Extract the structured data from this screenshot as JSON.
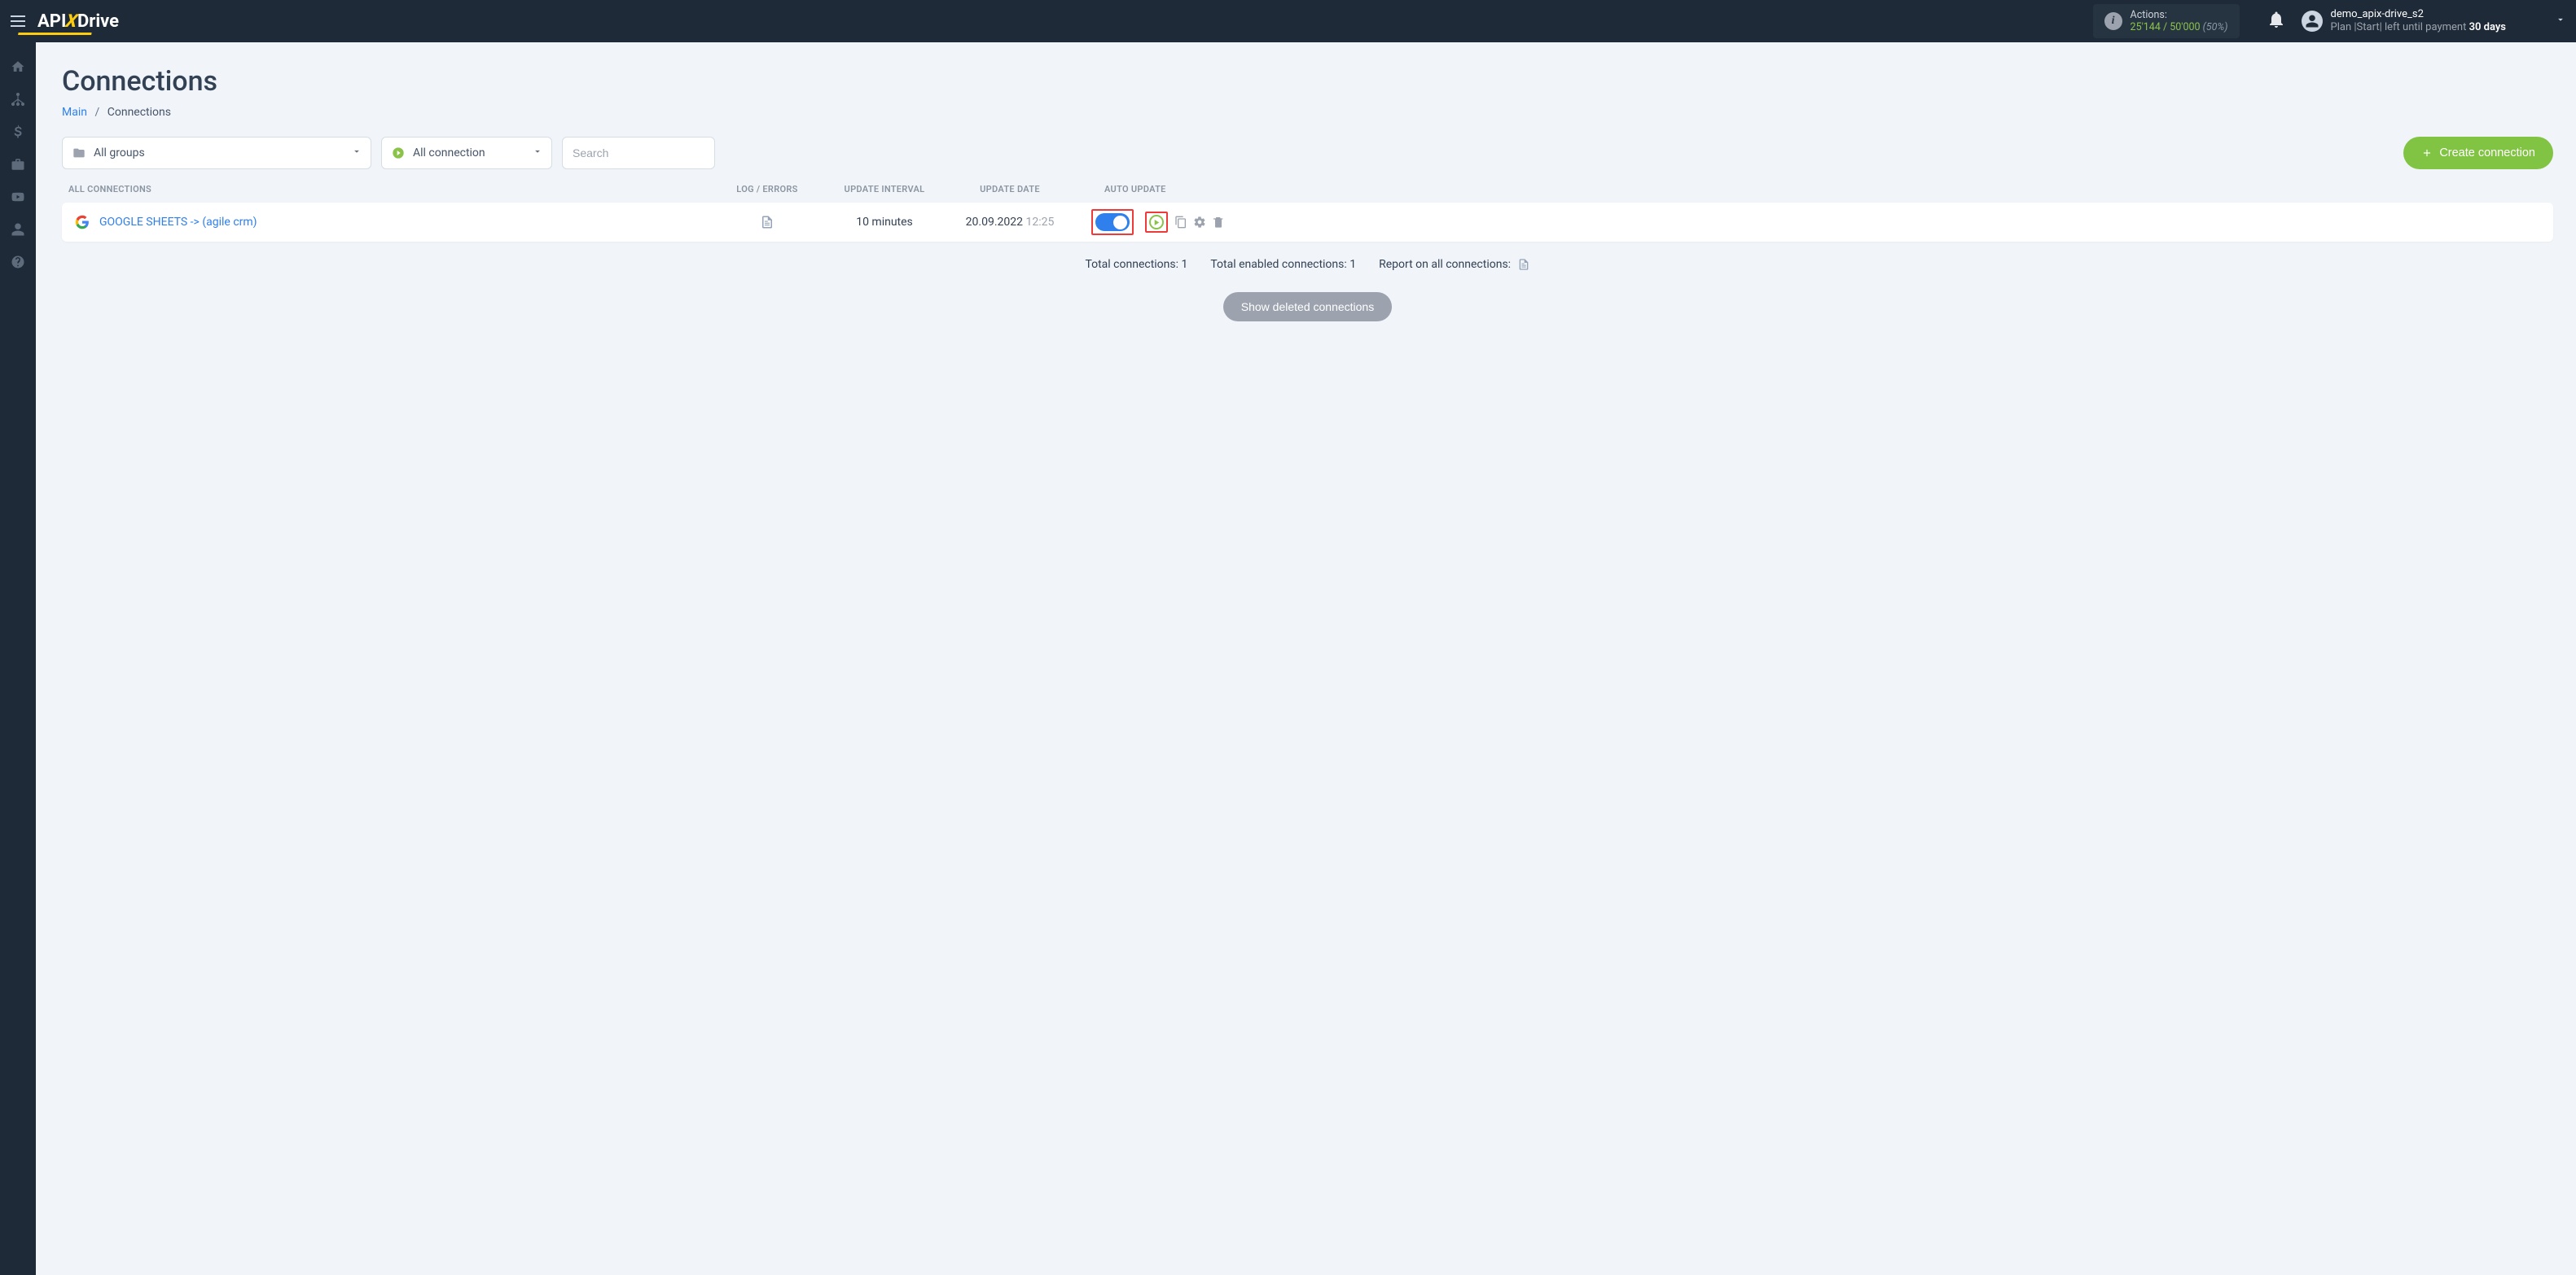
{
  "header": {
    "actions_label": "Actions:",
    "actions_used": "25'144",
    "actions_total": "50'000",
    "actions_pct": "(50%)",
    "user_name": "demo_apix-drive_s2",
    "plan_prefix": "Plan |Start| left until payment ",
    "plan_days": "30 days"
  },
  "page": {
    "title": "Connections",
    "breadcrumb_main": "Main",
    "breadcrumb_current": "Connections"
  },
  "controls": {
    "groups_label": "All groups",
    "status_label": "All connection",
    "search_placeholder": "Search",
    "create_label": "Create connection"
  },
  "table": {
    "header_all": "ALL CONNECTIONS",
    "header_log": "LOG / ERRORS",
    "header_interval": "UPDATE INTERVAL",
    "header_date": "UPDATE DATE",
    "header_auto": "AUTO UPDATE",
    "rows": [
      {
        "name": "GOOGLE SHEETS -> (agile crm)",
        "interval": "10 minutes",
        "date": "20.09.2022",
        "time": "12:25"
      }
    ]
  },
  "summary": {
    "total_connections": "Total connections: 1",
    "total_enabled": "Total enabled connections: 1",
    "report_label": "Report on all connections:"
  },
  "deleted_btn": "Show deleted connections"
}
